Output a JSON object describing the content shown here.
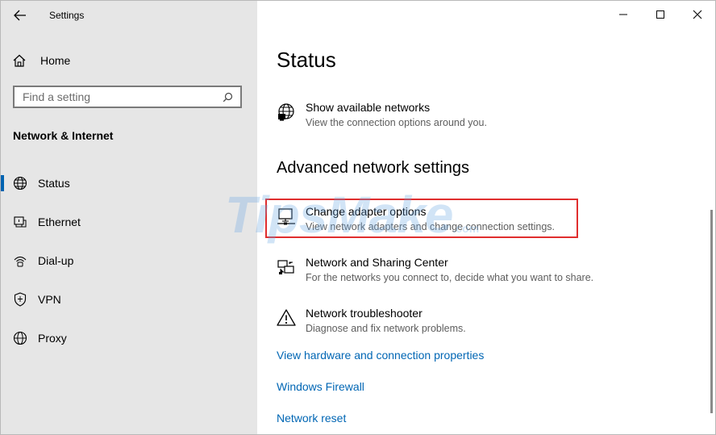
{
  "window": {
    "title": "Settings"
  },
  "sidebar": {
    "home_label": "Home",
    "search_placeholder": "Find a setting",
    "category": "Network & Internet",
    "items": [
      {
        "label": "Status",
        "icon": "status-globe-icon",
        "selected": true
      },
      {
        "label": "Ethernet",
        "icon": "ethernet-icon"
      },
      {
        "label": "Dial-up",
        "icon": "dialup-icon"
      },
      {
        "label": "VPN",
        "icon": "vpn-shield-icon"
      },
      {
        "label": "Proxy",
        "icon": "proxy-globe-icon"
      }
    ]
  },
  "main": {
    "title": "Status",
    "show_networks": {
      "title": "Show available networks",
      "desc": "View the connection options around you."
    },
    "advanced_title": "Advanced network settings",
    "entries": [
      {
        "title": "Change adapter options",
        "desc": "View network adapters and change connection settings.",
        "icon": "adapter-icon",
        "highlighted": true
      },
      {
        "title": "Network and Sharing Center",
        "desc": "For the networks you connect to, decide what you want to share.",
        "icon": "sharing-center-icon"
      },
      {
        "title": "Network troubleshooter",
        "desc": "Diagnose and fix network problems.",
        "icon": "warning-triangle-icon"
      }
    ],
    "links": [
      "View hardware and connection properties",
      "Windows Firewall",
      "Network reset"
    ]
  },
  "watermark": {
    "text": "TipsMake",
    "suffix": ".com"
  },
  "colors": {
    "sidebar_bg": "#e6e6e6",
    "accent": "#0063b1",
    "link": "#0066b4",
    "highlight": "#e02e2e"
  }
}
